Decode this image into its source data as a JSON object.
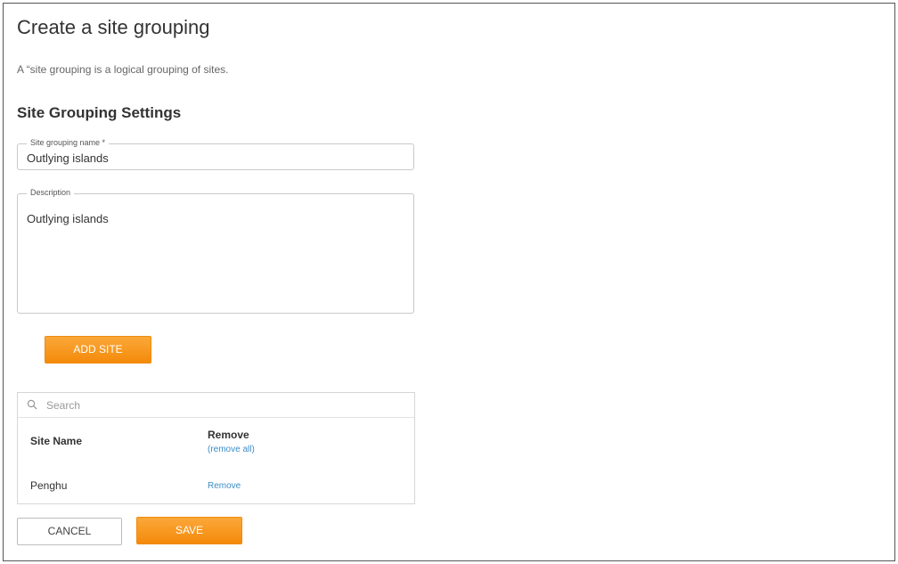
{
  "page": {
    "title": "Create a site grouping",
    "intro": "A “site grouping is a logical grouping of sites."
  },
  "settings": {
    "section_title": "Site Grouping Settings",
    "name_field": {
      "label": "Site grouping name *",
      "value": "Outlying islands"
    },
    "description_field": {
      "label": "Description",
      "value": "Outlying islands"
    }
  },
  "add_site_button": "ADD SITE",
  "sites_panel": {
    "search_placeholder": "Search",
    "search_icon": "search-icon",
    "column_site_name": "Site Name",
    "column_remove": "Remove",
    "remove_all_link": "(remove all)",
    "rows": [
      {
        "site_name": "Penghu",
        "remove_label": "Remove"
      }
    ]
  },
  "footer": {
    "cancel_label": "CANCEL",
    "save_label": "SAVE"
  },
  "colors": {
    "accent": "#f7941d",
    "link": "#3a8dc9"
  }
}
